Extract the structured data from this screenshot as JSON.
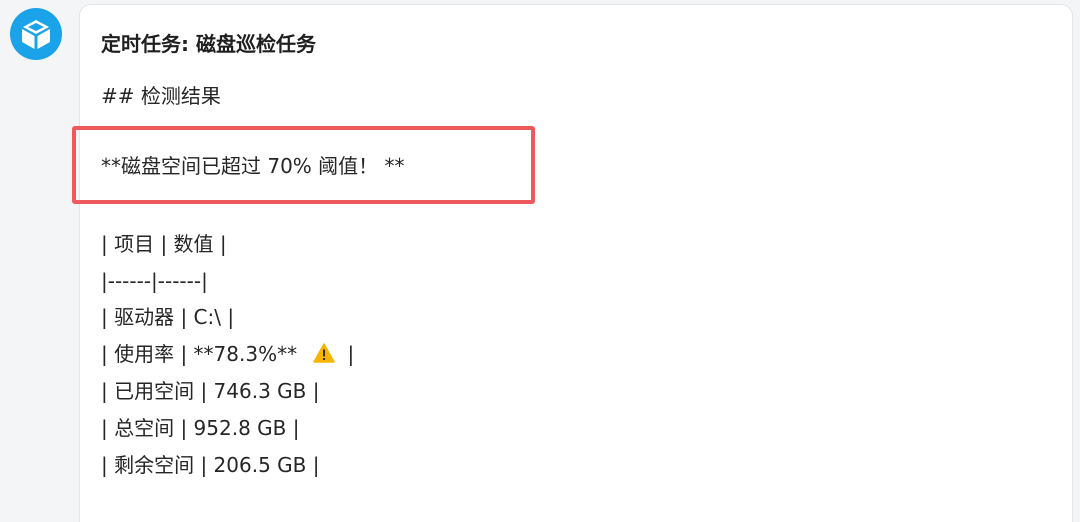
{
  "card": {
    "title": "定时任务: 磁盘巡检任务",
    "heading": "## 检测结果",
    "alert": "**磁盘空间已超过 70% 阈值！ **",
    "table_lines": [
      "| 项目 | 数值 |",
      "|------|------|",
      "| 驱动器 | C:\\ |",
      "| 使用率 | **78.3%** ",
      "| 已用空间 | 746.3 GB |",
      "| 总空间 | 952.8 GB |",
      "| 剩余空间 | 206.5 GB |"
    ],
    "usage_row_tail": "|"
  },
  "colors": {
    "avatar_blue": "#1aa3e8",
    "highlight_red": "#f0595b",
    "warning_yellow": "#f7b500"
  },
  "icons": {
    "avatar": "cube-icon",
    "warning": "warning-icon"
  }
}
